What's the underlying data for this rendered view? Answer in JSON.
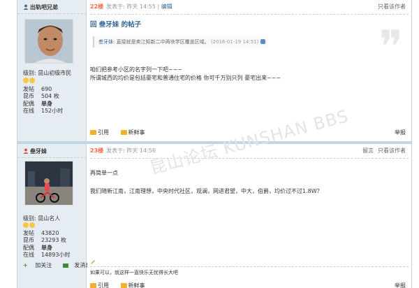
{
  "posts": [
    {
      "author": "出轨吧兄弟",
      "level": "级别: 昆山初级市民",
      "stats": [
        {
          "k": "发帖",
          "v": "690"
        },
        {
          "k": "昆币",
          "v": "504 枚"
        },
        {
          "k": "配偶",
          "v": "单身"
        },
        {
          "k": "在线",
          "v": "152小时"
        }
      ],
      "floor": "22楼",
      "meta": "发表于: 昨天 14:55",
      "edit": "编辑",
      "right_links": [
        "只看该作者"
      ],
      "title": "回 叁牙妹 的帖子",
      "quote_user": "叁牙妹",
      "quote_text": ": 直接就是卖江知新二中两块学区覆盖区域。",
      "quote_time": "(2016-01-19 14:51)",
      "body": [
        "咱们把参考小区的名字列一下吧~~~",
        "所谓城西的均价是包括豪宅和普通住宅的价格 你可千万别只列 豪宅出来~~~"
      ],
      "foot_links": [
        "引用",
        "新鲜事"
      ],
      "report": "举报"
    },
    {
      "author": "叁牙妹",
      "level": "级别: 昆山名人",
      "stats": [
        {
          "k": "发帖",
          "v": "43820"
        },
        {
          "k": "昆币",
          "v": "23293 枚"
        },
        {
          "k": "配偶",
          "v": "单身"
        },
        {
          "k": "在线",
          "v": "14893小时"
        }
      ],
      "follow": [
        "加关注",
        "发消息"
      ],
      "floor": "23楼",
      "meta": "发表于: 昨天 14:56",
      "right_links": [
        "留言",
        "只看该作者"
      ],
      "body": [
        "再简单一点",
        "我们随新江南，江南理想，中央时代社区，观澜，网进君望，中大，伯爵，均价过不过1.8W？"
      ],
      "signature": "如果可以，就这样一直快乐无忧得长大吧",
      "foot_links": [
        "引用",
        "新鲜事"
      ],
      "report": "举报"
    }
  ],
  "watermark": "昆山论坛 KUNSHAN BBS",
  "colors": {
    "floor": "#f26c4f",
    "link": "#336699",
    "sidebar": "#e5edf2",
    "border": "#c2d5e3"
  }
}
